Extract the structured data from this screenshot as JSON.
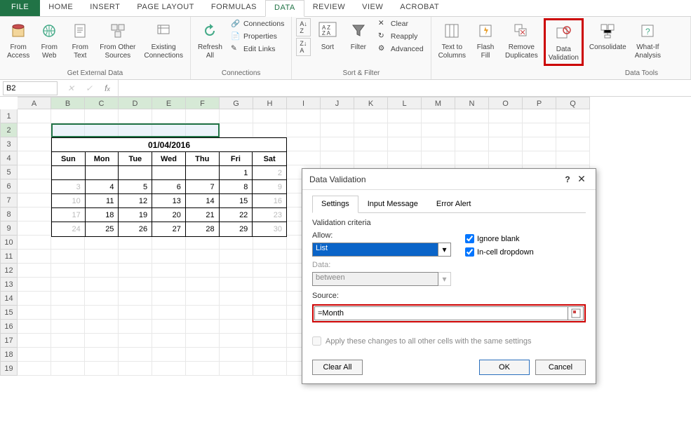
{
  "tabs": {
    "file": "FILE",
    "items": [
      "HOME",
      "INSERT",
      "PAGE LAYOUT",
      "FORMULAS",
      "DATA",
      "REVIEW",
      "VIEW",
      "ACROBAT"
    ],
    "active": "DATA"
  },
  "ribbon": {
    "get_external": {
      "label": "Get External Data",
      "from_access": "From\nAccess",
      "from_web": "From\nWeb",
      "from_text": "From\nText",
      "from_other": "From Other\nSources",
      "existing": "Existing\nConnections"
    },
    "connections": {
      "label": "Connections",
      "refresh": "Refresh\nAll",
      "connections": "Connections",
      "properties": "Properties",
      "edit_links": "Edit Links"
    },
    "sort_filter": {
      "label": "Sort & Filter",
      "sort_asc": "A→Z",
      "sort_desc": "Z→A",
      "sort": "Sort",
      "filter": "Filter",
      "clear": "Clear",
      "reapply": "Reapply",
      "advanced": "Advanced"
    },
    "data_tools": {
      "label": "Data Tools",
      "text_to_columns": "Text to\nColumns",
      "flash_fill": "Flash\nFill",
      "remove_dup": "Remove\nDuplicates",
      "data_validation": "Data\nValidation",
      "consolidate": "Consolidate",
      "what_if": "What-If\nAnalysis"
    }
  },
  "namebox": "B2",
  "columns": [
    "A",
    "B",
    "C",
    "D",
    "E",
    "F",
    "G",
    "H",
    "I",
    "J",
    "K",
    "L",
    "M",
    "N",
    "O",
    "P",
    "Q"
  ],
  "selected_cols": [
    "B",
    "C",
    "D",
    "E",
    "F"
  ],
  "rows": [
    1,
    2,
    3,
    4,
    5,
    6,
    7,
    8,
    9,
    10,
    11,
    12,
    13,
    14,
    15,
    16,
    17,
    18,
    19
  ],
  "selected_row": 2,
  "calendar": {
    "title": "01/04/2016",
    "days": [
      "Sun",
      "Mon",
      "Tue",
      "Wed",
      "Thu",
      "Fri",
      "Sat"
    ],
    "grid": [
      [
        {
          "v": "",
          "g": false
        },
        {
          "v": "",
          "g": false
        },
        {
          "v": "",
          "g": false
        },
        {
          "v": "",
          "g": false
        },
        {
          "v": "",
          "g": false
        },
        {
          "v": "1",
          "g": false
        },
        {
          "v": "2",
          "g": true
        }
      ],
      [
        {
          "v": "3",
          "g": true
        },
        {
          "v": "4",
          "g": false
        },
        {
          "v": "5",
          "g": false
        },
        {
          "v": "6",
          "g": false
        },
        {
          "v": "7",
          "g": false
        },
        {
          "v": "8",
          "g": false
        },
        {
          "v": "9",
          "g": true
        }
      ],
      [
        {
          "v": "10",
          "g": true
        },
        {
          "v": "11",
          "g": false
        },
        {
          "v": "12",
          "g": false
        },
        {
          "v": "13",
          "g": false
        },
        {
          "v": "14",
          "g": false
        },
        {
          "v": "15",
          "g": false
        },
        {
          "v": "16",
          "g": true
        }
      ],
      [
        {
          "v": "17",
          "g": true
        },
        {
          "v": "18",
          "g": false
        },
        {
          "v": "19",
          "g": false
        },
        {
          "v": "20",
          "g": false
        },
        {
          "v": "21",
          "g": false
        },
        {
          "v": "22",
          "g": false
        },
        {
          "v": "23",
          "g": true
        }
      ],
      [
        {
          "v": "24",
          "g": true
        },
        {
          "v": "25",
          "g": false
        },
        {
          "v": "26",
          "g": false
        },
        {
          "v": "27",
          "g": false
        },
        {
          "v": "28",
          "g": false
        },
        {
          "v": "29",
          "g": false
        },
        {
          "v": "30",
          "g": true
        }
      ]
    ]
  },
  "dialog": {
    "title": "Data Validation",
    "tabs": [
      "Settings",
      "Input Message",
      "Error Alert"
    ],
    "active_tab": "Settings",
    "criteria_label": "Validation criteria",
    "allow_label": "Allow:",
    "allow_value": "List",
    "data_label": "Data:",
    "data_value": "between",
    "ignore_blank": "Ignore blank",
    "incell_dropdown": "In-cell dropdown",
    "source_label": "Source:",
    "source_value": "=Month",
    "apply_label": "Apply these changes to all other cells with the same settings",
    "clear_all": "Clear All",
    "ok": "OK",
    "cancel": "Cancel"
  }
}
